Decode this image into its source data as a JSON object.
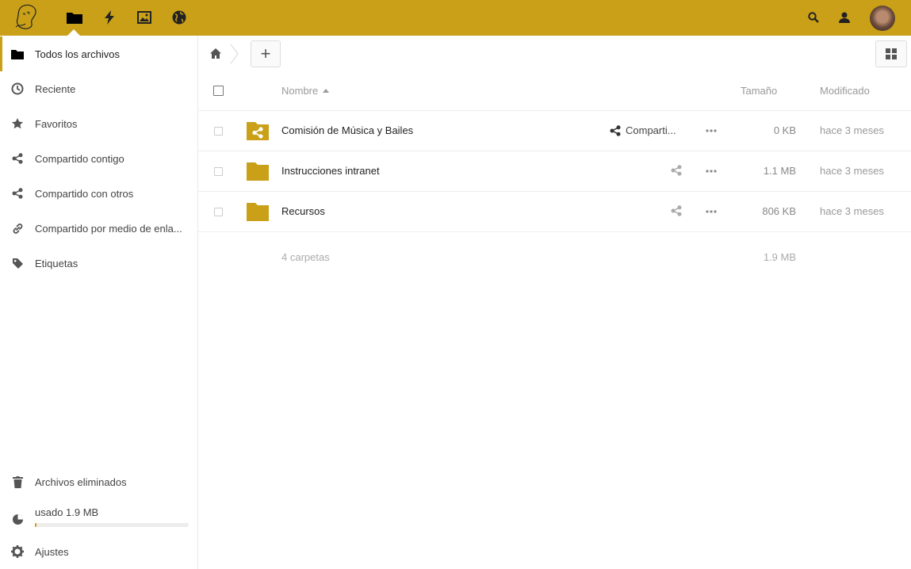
{
  "header": {
    "apps": [
      "files-icon",
      "activity-icon",
      "gallery-icon",
      "globe-icon"
    ],
    "right_icons": [
      "search-icon",
      "contacts-icon"
    ]
  },
  "sidebar": {
    "items": [
      {
        "label": "Todos los archivos",
        "icon": "folder-icon"
      },
      {
        "label": "Reciente",
        "icon": "clock-icon"
      },
      {
        "label": "Favoritos",
        "icon": "star-icon"
      },
      {
        "label": "Compartido contigo",
        "icon": "share-icon"
      },
      {
        "label": "Compartido con otros",
        "icon": "share-icon"
      },
      {
        "label": "Compartido por medio de enla...",
        "icon": "link-icon"
      },
      {
        "label": "Etiquetas",
        "icon": "tag-icon"
      }
    ],
    "trash_label": "Archivos eliminados",
    "quota_label": "usado 1.9 MB",
    "quota_fraction": 0.01,
    "settings_label": "Ajustes"
  },
  "table": {
    "col_name": "Nombre",
    "col_size": "Tamaño",
    "col_modified": "Modificado",
    "rows": [
      {
        "name": "Comisión de Música y Bailes",
        "share_label": "Comparti...",
        "size": "0 KB",
        "modified": "hace 3 meses"
      },
      {
        "name": "Instrucciones intranet",
        "share_label": "",
        "size": "1.1 MB",
        "modified": "hace 3 meses"
      },
      {
        "name": "Recursos",
        "share_label": "",
        "size": "806 KB",
        "modified": "hace 3 meses"
      }
    ],
    "summary_count": "4 carpetas",
    "summary_size": "1.9 MB"
  },
  "colors": {
    "accent": "#c9a018"
  }
}
